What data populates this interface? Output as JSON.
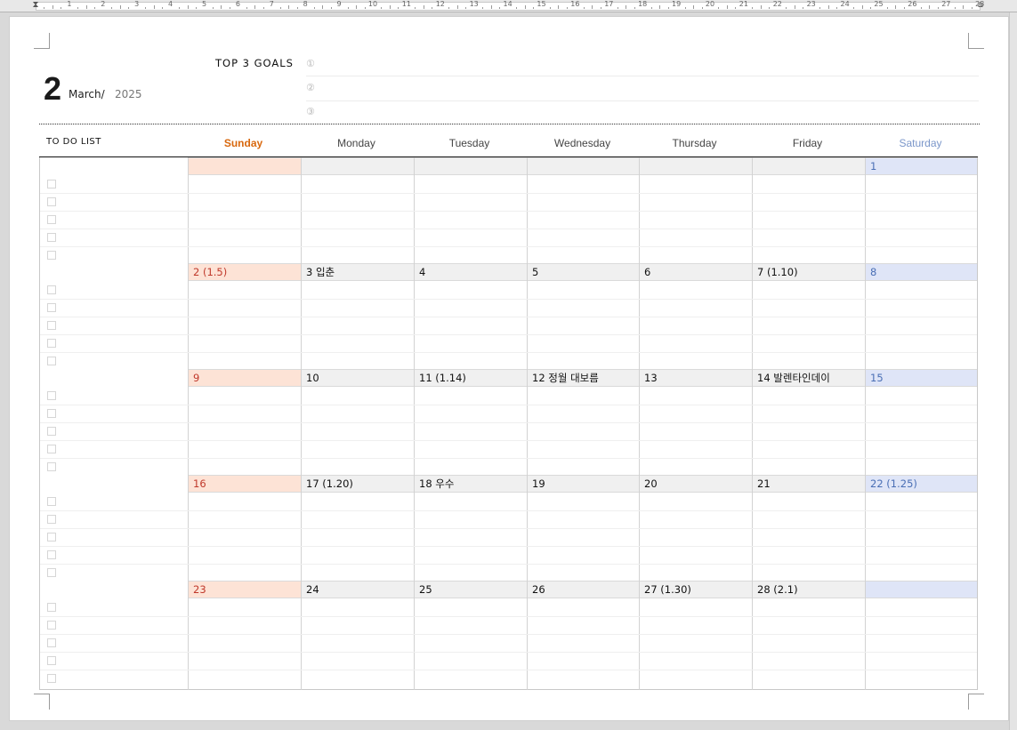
{
  "ruler": {
    "numbers": [
      "1",
      "2",
      "3",
      "4",
      "5",
      "6",
      "7",
      "8",
      "9",
      "10",
      "11",
      "12",
      "13",
      "14",
      "15",
      "16",
      "17",
      "18",
      "19",
      "20",
      "21",
      "22",
      "23",
      "24",
      "25",
      "26",
      "27",
      "28"
    ]
  },
  "header": {
    "month_number": "2",
    "month_name": "March/",
    "year": "2025",
    "goals_title": "TOP 3 GOALS",
    "goal_marks": [
      "①",
      "②",
      "③"
    ]
  },
  "calendar": {
    "todo_title": "TO DO LIST",
    "days": [
      "Sunday",
      "Monday",
      "Tuesday",
      "Wednesday",
      "Thursday",
      "Friday",
      "Saturday"
    ],
    "weeks": [
      [
        "",
        "",
        "",
        "",
        "",
        "",
        "1"
      ],
      [
        "2  (1.5)",
        "3  입춘",
        "4",
        "5",
        "6",
        "7  (1.10)",
        "8"
      ],
      [
        "9",
        "10",
        "11  (1.14)",
        "12  정월 대보름",
        "13",
        "14  발렌타인데이",
        "15"
      ],
      [
        "16",
        "17  (1.20)",
        "18  우수",
        "19",
        "20",
        "21",
        "22  (1.25)"
      ],
      [
        "23",
        "24",
        "25",
        "26",
        "27  (1.30)",
        "28  (2.1)",
        ""
      ]
    ]
  },
  "colors": {
    "sunday_header": "#d8680e",
    "saturday_header": "#7a96c9",
    "sunday_cell": "#fde3d6",
    "saturday_cell": "#dfe5f7",
    "weekday_cell": "#f0f0f0"
  }
}
